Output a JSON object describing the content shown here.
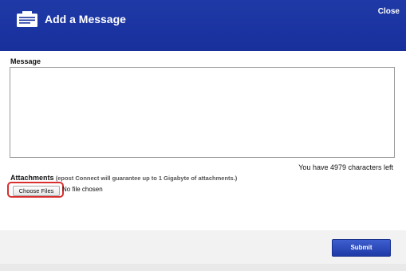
{
  "header": {
    "icon": "message-icon",
    "title": "Add a Message",
    "close_label": "Close",
    "bg_color": "#1a33a0"
  },
  "form": {
    "message_label": "Message",
    "message_value": "",
    "chars_left": "You have 4979 characters left",
    "attachments_label": "Attachments",
    "attachments_note": "(epost Connect will guarantee up to 1 Gigabyte of attachments.)",
    "choose_files_label": "Choose Files",
    "file_status": "No file chosen",
    "highlight_color": "#d92f2f"
  },
  "footer": {
    "submit_label": "Submit",
    "submit_color": "#1f3aa6"
  }
}
